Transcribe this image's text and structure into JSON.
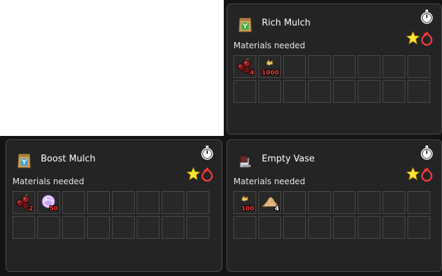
{
  "colors": {
    "quantity_short": "#ff3b3b",
    "quantity_ok": "#ffffff"
  },
  "recipes": [
    {
      "title": "Rich Mulch",
      "icon": "green-seed-pouch-icon",
      "materials_label": "Materials needed",
      "materials": [
        {
          "icon": "berries-icon",
          "qty": "4",
          "sufficient": false
        },
        {
          "icon": "sap-icon",
          "qty": "1000",
          "sufficient": false
        }
      ]
    },
    {
      "title": "Boost Mulch",
      "icon": "blue-seed-pouch-icon",
      "materials_label": "Materials needed",
      "materials": [
        {
          "icon": "berries-icon",
          "qty": "2",
          "sufficient": false
        },
        {
          "icon": "purple-gem-icon",
          "qty": "50",
          "sufficient": false
        }
      ]
    },
    {
      "title": "Empty Vase",
      "icon": "vase-icon",
      "materials_label": "Materials needed",
      "materials": [
        {
          "icon": "sap-icon",
          "qty": "100",
          "sufficient": false
        },
        {
          "icon": "sand-pile-icon",
          "qty": "4",
          "sufficient": true
        }
      ]
    }
  ]
}
